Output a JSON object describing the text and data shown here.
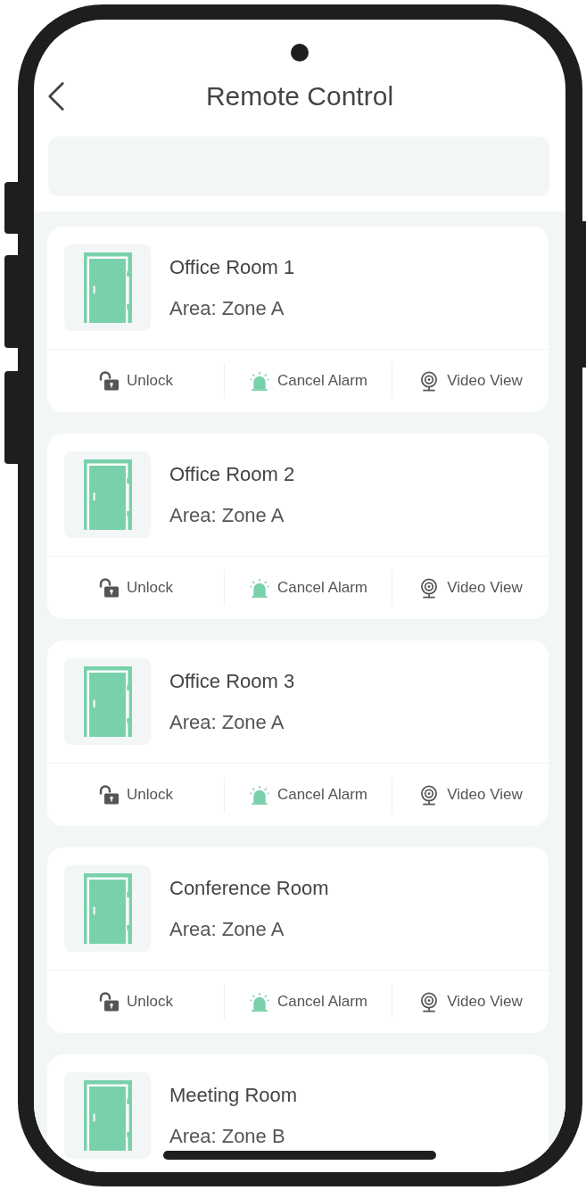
{
  "header": {
    "title": "Remote Control"
  },
  "rooms": [
    {
      "name": "Office Room 1",
      "area": "Area: Zone A",
      "actions": [
        {
          "kind": "unlock",
          "label": "Unlock"
        },
        {
          "kind": "alarm",
          "label": "Cancel Alarm"
        },
        {
          "kind": "video",
          "label": "Video View"
        }
      ]
    },
    {
      "name": "Office Room 2",
      "area": "Area: Zone A",
      "actions": [
        {
          "kind": "unlock",
          "label": "Unlock"
        },
        {
          "kind": "alarm",
          "label": "Cancel Alarm"
        },
        {
          "kind": "video",
          "label": "Video View"
        }
      ]
    },
    {
      "name": "Office Room 3",
      "area": "Area: Zone A",
      "actions": [
        {
          "kind": "unlock",
          "label": "Unlock"
        },
        {
          "kind": "alarm",
          "label": "Cancel Alarm"
        },
        {
          "kind": "video",
          "label": "Video View"
        }
      ]
    },
    {
      "name": "Conference Room",
      "area": "Area: Zone A",
      "actions": [
        {
          "kind": "unlock",
          "label": "Unlock"
        },
        {
          "kind": "alarm",
          "label": "Cancel Alarm"
        },
        {
          "kind": "video",
          "label": "Video View"
        }
      ]
    },
    {
      "name": "Meeting Room",
      "area": "Area: Zone B"
    }
  ]
}
